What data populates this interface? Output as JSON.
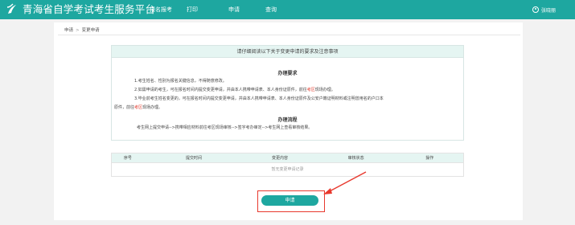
{
  "header": {
    "title": "青海省自学考试考生服务平台",
    "nav": [
      "报名报考",
      "打印",
      "申请",
      "查询"
    ],
    "user": "张晓丽"
  },
  "breadcrumb": [
    "申请",
    "变更申请"
  ],
  "notice": {
    "heading": "请仔细阅读以下关于变更申请的要求及注意事项",
    "requirements_title": "办理要求",
    "req1": "1.考生姓名、性别为报名关键信息，不得随意修改。",
    "req2a": "2.如需申请的考生，可在报名时间内提交变更申请，并由本人携带申请表、本人身份证原件，前往",
    "req2_red": "考区",
    "req2b": "现场办理。",
    "req3a": "3.毕业前考生姓名变更的，可在报名时间内提交变更申请，并由本人携带申请表、本人身份证原件及公安户籍证明材料或注明曾用名的户口本",
    "req3b_pre": "原件，前往",
    "req3_red": "考区",
    "req3b_post": "现场办理。",
    "process_title": "办理流程",
    "process": "考生网上提交申请-->携带相应材料前往考区现场审核-->签字考办审定-->考生网上查看审核结果。"
  },
  "table": {
    "columns": [
      "序号",
      "提交时间",
      "变更内容",
      "审核状态",
      "操作"
    ],
    "empty_text": "暂无变更申请记录"
  },
  "apply_label": "申请",
  "colors": {
    "primary": "#1ea7a0",
    "highlight": "#e8392e"
  }
}
